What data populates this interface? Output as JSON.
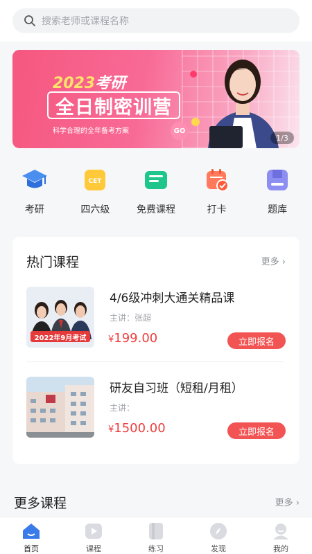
{
  "search": {
    "placeholder": "搜索老师或课程名称"
  },
  "banner": {
    "year": "2023",
    "year_suffix": "考研",
    "title": "全日制密训营",
    "subtitle": "科学合理的全年备考方案",
    "go_label": "GO",
    "counter": "1/3"
  },
  "categories": [
    {
      "label": "考研",
      "icon": "graduation-cap-icon"
    },
    {
      "label": "四六级",
      "icon": "cet-icon"
    },
    {
      "label": "免费课程",
      "icon": "free-course-icon"
    },
    {
      "label": "打卡",
      "icon": "calendar-check-icon"
    },
    {
      "label": "题库",
      "icon": "question-bank-icon"
    }
  ],
  "hot_courses": {
    "title": "热门课程",
    "more": "更多",
    "items": [
      {
        "name": "4/6级冲刺大通关精品课",
        "teacher": "主讲：张超",
        "price_symbol": "¥",
        "price": "199.00",
        "button": "立即报名",
        "thumb_caption": "2022年9月考试"
      },
      {
        "name": "研友自习班（短租/月租）",
        "teacher": "主讲：",
        "price_symbol": "¥",
        "price": "1500.00",
        "button": "立即报名"
      }
    ]
  },
  "more_courses": {
    "title": "更多课程",
    "more": "更多"
  },
  "tabbar": [
    {
      "label": "首页",
      "icon": "home-icon",
      "active": true
    },
    {
      "label": "课程",
      "icon": "play-icon",
      "active": false
    },
    {
      "label": "练习",
      "icon": "book-icon",
      "active": false
    },
    {
      "label": "发现",
      "icon": "compass-icon",
      "active": false
    },
    {
      "label": "我的",
      "icon": "user-icon",
      "active": false
    }
  ],
  "colors": {
    "accent_red": "#f25353",
    "price_red": "#ee3f3f",
    "banner_pink": "#f5577f",
    "tab_active_blue": "#3a7bea"
  }
}
